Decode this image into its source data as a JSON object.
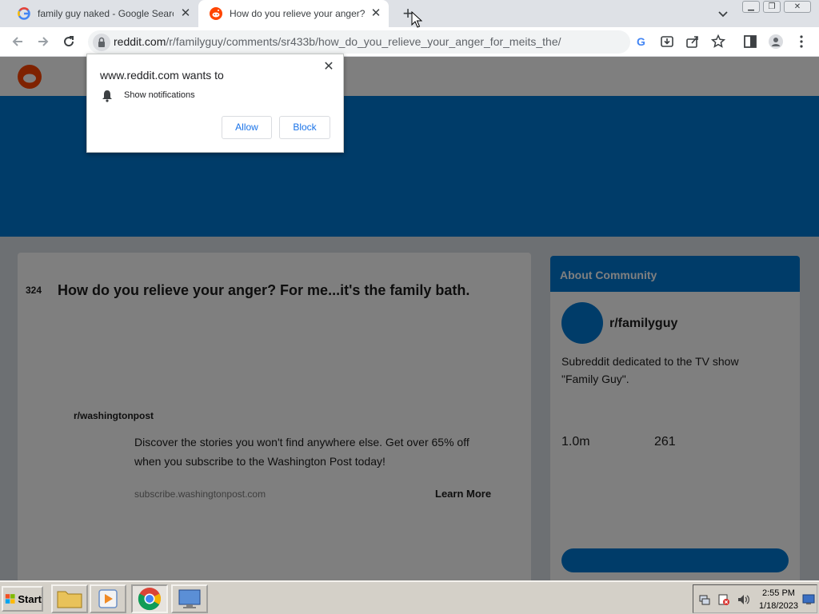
{
  "browser": {
    "tabs": [
      {
        "title": "family guy naked - Google Search",
        "icon": "google-icon"
      },
      {
        "title": "How do you relieve your anger? For me...it's the family bath.",
        "icon": "reddit-icon",
        "active": true
      }
    ],
    "url_domain": "reddit.com",
    "url_rest": "/r/familyguy/comments/sr433b/how_do_you_relieve_your_anger_for_meits_the/"
  },
  "permission_popup": {
    "title": "www.reddit.com wants to",
    "permission": "Show notifications",
    "allow_label": "Allow",
    "block_label": "Block"
  },
  "page": {
    "post_title": "How do you relieve your anger? For me...it's the family bath.",
    "vote_count": "324",
    "ad_text": "Discover the stories you won't find anywhere else. Get over 65% off when you subscribe to the Washington Post today!",
    "ad_source": "r/washingtonpost",
    "ad_link": "subscribe.washingtonpost.com",
    "learn_more": "Learn More",
    "side_head": "About Community",
    "subreddit": "r/familyguy",
    "sub_desc": "Subreddit dedicated to the TV show \"Family Guy\".",
    "members": "1.0m",
    "online": "261",
    "colors": {
      "banner": "#0079d3",
      "reddit_orange": "#ff4500"
    }
  },
  "taskbar": {
    "start_label": "Start",
    "time": "2:55 PM",
    "date": "1/18/2023"
  }
}
